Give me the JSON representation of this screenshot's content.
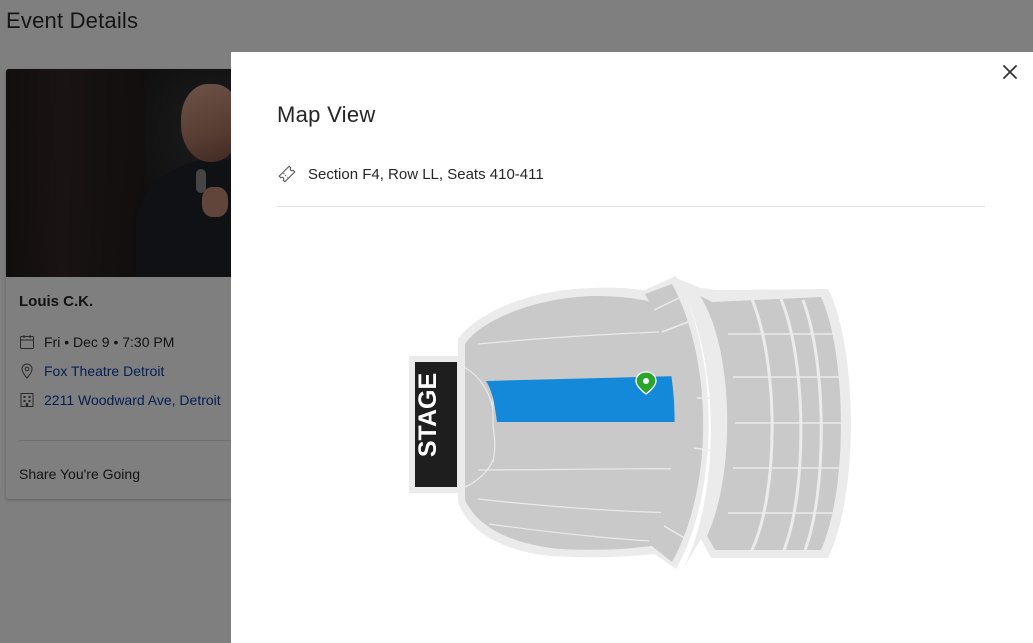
{
  "page": {
    "title": "Event Details"
  },
  "event": {
    "name": "Louis C.K.",
    "date_time": "Fri • Dec 9 • 7:30 PM",
    "venue": "Fox Theatre Detroit",
    "address": "2211 Woodward Ave, Detroit",
    "share_label": "Share You're Going"
  },
  "modal": {
    "title": "Map View",
    "seat_info": "Section F4, Row LL, Seats 410-411",
    "close_icon": "close-icon",
    "ticket_icon": "ticket-icon"
  },
  "seat_map": {
    "stage_label": "STAGE",
    "highlight_color": "#1589d9",
    "marker_color": "#2aa52a",
    "section_fill": "#c8c8c8",
    "outline_fill": "#ececec"
  }
}
